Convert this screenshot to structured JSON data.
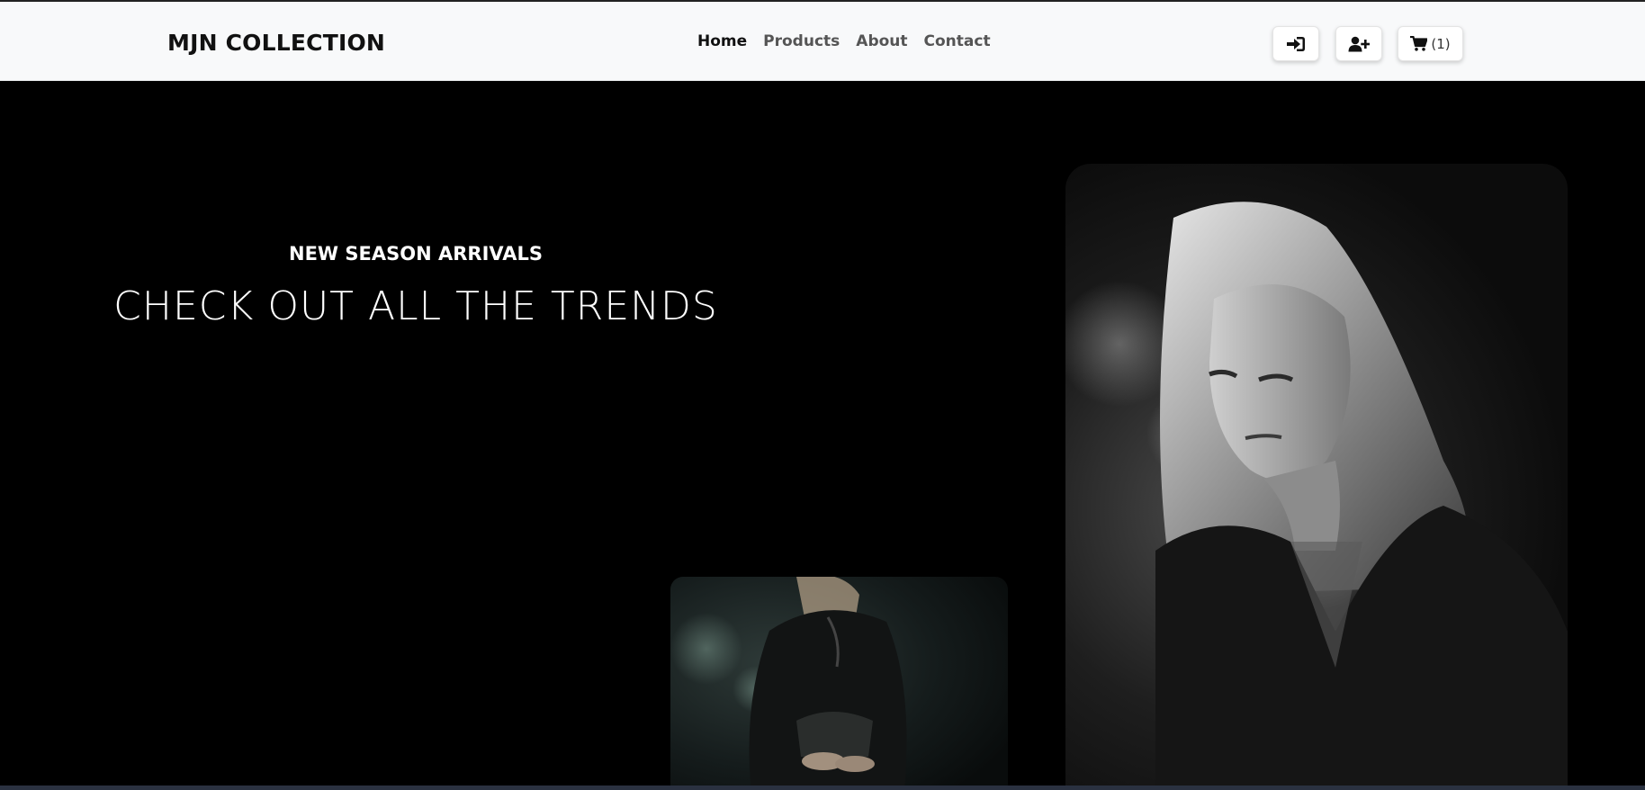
{
  "navbar": {
    "brand": "MJN COLLECTION",
    "links": [
      {
        "label": "Home",
        "active": true
      },
      {
        "label": "Products",
        "active": false
      },
      {
        "label": "About",
        "active": false
      },
      {
        "label": "Contact",
        "active": false
      }
    ],
    "buttons": {
      "login_icon": "sign-in-icon",
      "register_icon": "user-plus-icon",
      "cart_icon": "shopping-cart-icon",
      "cart_count": "(1)"
    }
  },
  "hero": {
    "kicker": "NEW SEASON ARRIVALS",
    "title": "CHECK OUT ALL THE TRENDS",
    "background_color": "#000000",
    "images": {
      "large": "woman-portrait-photo",
      "small": "seated-model-photo"
    }
  }
}
